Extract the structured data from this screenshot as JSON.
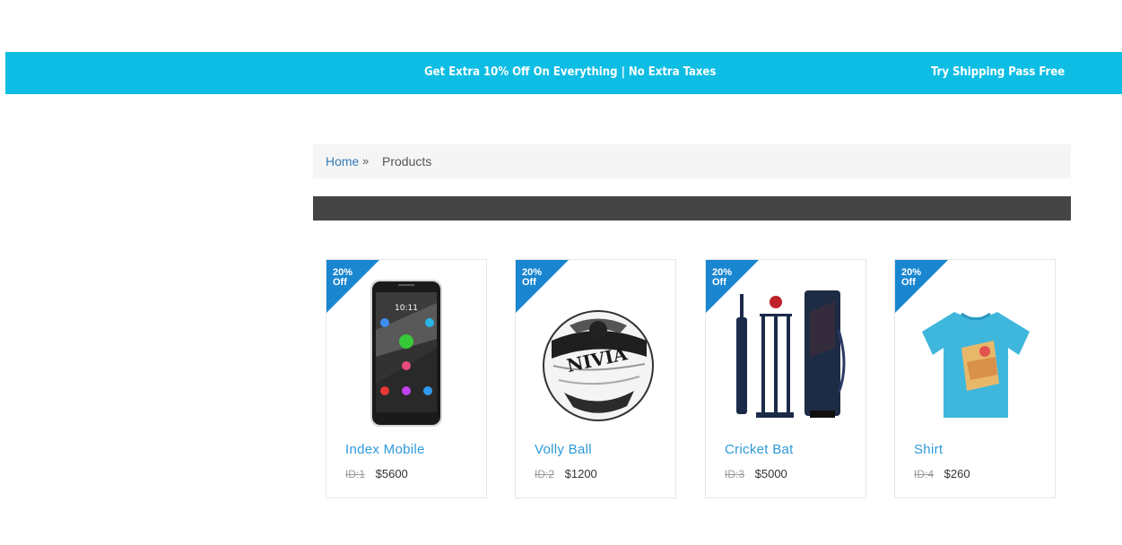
{
  "promo": {
    "message_1": "Get Extra 10% Off On Everything | No Extra Taxes",
    "message_2": "Try Shipping Pass Free"
  },
  "breadcrumb": {
    "home": "Home",
    "separator": "»",
    "current": "Products"
  },
  "colors": {
    "promo_bg": "#0dbde3",
    "ribbon": "#1a86d0",
    "product_name": "#2d9ad9",
    "dark_bar": "#444444"
  },
  "products": [
    {
      "name": "Index Mobile",
      "badge": "20% Off",
      "badge_line1": "20%",
      "badge_line2": "Off",
      "id": "ID:1",
      "price": "$5600",
      "image": "phone-image"
    },
    {
      "name": "Volly Ball",
      "badge": "20% Off",
      "badge_line1": "20%",
      "badge_line2": "Off",
      "id": "ID:2",
      "price": "$1200",
      "image": "ball-image"
    },
    {
      "name": "Cricket Bat",
      "badge": "20% Off",
      "badge_line1": "20%",
      "badge_line2": "Off",
      "id": "ID:3",
      "price": "$5000",
      "image": "cricket-set-image"
    },
    {
      "name": "Shirt",
      "badge": "20% Off",
      "badge_line1": "20%",
      "badge_line2": "Off",
      "id": "ID:4",
      "price": "$260",
      "image": "tshirt-image"
    }
  ]
}
